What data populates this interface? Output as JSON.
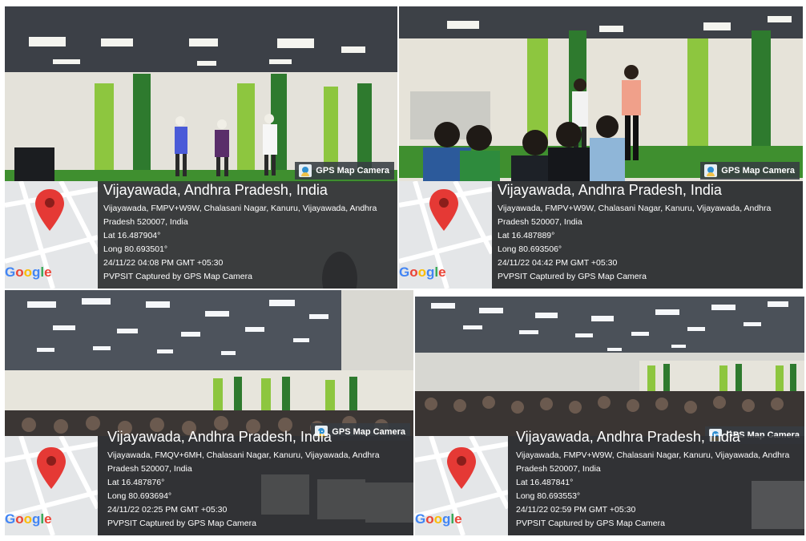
{
  "photos": [
    {
      "badge": "GPS Map Camera",
      "title": "Vijayawada, Andhra Pradesh, India",
      "address": "Vijayawada, FMPV+W9W, Chalasani Nagar, Kanuru, Vijayawada, Andhra Pradesh 520007, India",
      "lat": "Lat 16.487904°",
      "long": "Long 80.693501°",
      "datetime": "24/11/22 04:08 PM GMT +05:30",
      "caption": "PVPSIT Captured by GPS Map Camera"
    },
    {
      "badge": "GPS Map Camera",
      "title": "Vijayawada, Andhra Pradesh, India",
      "address": "Vijayawada, FMPV+W9W, Chalasani Nagar, Kanuru, Vijayawada, Andhra Pradesh 520007, India",
      "lat": "Lat 16.487889°",
      "long": "Long 80.693506°",
      "datetime": "24/11/22 04:42 PM GMT +05:30",
      "caption": "PVPSIT Captured by GPS Map Camera"
    },
    {
      "badge": "GPS Map Camera",
      "title": "Vijayawada, Andhra Pradesh, India",
      "address": "Vijayawada, FMQV+6MH, Chalasani Nagar, Kanuru, Vijayawada, Andhra Pradesh 520007, India",
      "lat": "Lat 16.487876°",
      "long": "Long 80.693694°",
      "datetime": "24/11/22 02:25 PM GMT +05:30",
      "caption": "PVPSIT Captured by GPS Map Camera"
    },
    {
      "badge": "GPS Map Camera",
      "title": "Vijayawada, Andhra Pradesh, India",
      "address": "Vijayawada, FMPV+W9W, Chalasani Nagar, Kanuru, Vijayawada, Andhra Pradesh 520007, India",
      "lat": "Lat 16.487841°",
      "long": "Long 80.693553°",
      "datetime": "24/11/22 02:59 PM GMT +05:30",
      "caption": "PVPSIT Captured by GPS Map Camera"
    }
  ],
  "map_logo": {
    "g1": "G",
    "o1": "o",
    "o2": "o",
    "g2": "g",
    "l": "l",
    "e": "e"
  },
  "colors": {
    "pin": "#e53935",
    "overlay": "#303236",
    "stage_green": "#3f8f2f",
    "wall_green": "#8dc63f"
  }
}
